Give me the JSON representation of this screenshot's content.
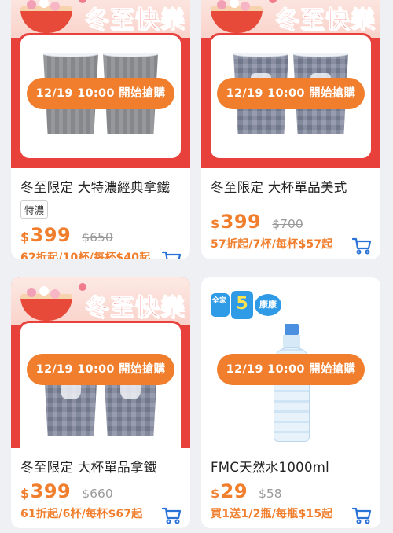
{
  "products": [
    {
      "image_theme": "winter-solstice",
      "banner_title": "冬至快樂",
      "sale_pill": "12/19 10:00 開始搶購",
      "name": "冬至限定 大特濃經典拿鐵",
      "tag": "特濃",
      "currency": "$",
      "price": "399",
      "original_price": "$650",
      "promo": "62折起/10杯/每杯$40起"
    },
    {
      "image_theme": "winter-solstice",
      "banner_title": "冬至快樂",
      "sale_pill": "12/19 10:00 開始搶購",
      "name": "冬至限定 大杯單品美式",
      "tag": "",
      "currency": "$",
      "price": "399",
      "original_price": "$700",
      "promo": "57折起/7杯/每杯$57起"
    },
    {
      "image_theme": "winter-solstice",
      "banner_title": "冬至快樂",
      "sale_pill": "12/19 10:00 開始搶購",
      "name": "冬至限定 大杯單品拿鐵",
      "tag": "",
      "currency": "$",
      "price": "399",
      "original_price": "$660",
      "promo": "61折起/6杯/每杯$67起"
    },
    {
      "image_theme": "water-bottle",
      "logo_text": {
        "a": "全家",
        "b": "5",
        "c": "康康"
      },
      "sale_pill": "12/19 10:00 開始搶購",
      "name": "FMC天然水1000ml",
      "tag": "",
      "currency": "$",
      "price": "29",
      "original_price": "$58",
      "promo": "買1送1/2瓶/每瓶$15起"
    }
  ],
  "colors": {
    "accent_orange": "#f07e2c",
    "festive_red": "#e8403a",
    "background": "#eef0f3",
    "cart_icon": "#2a72d6"
  },
  "icons": {
    "cart": "shopping-cart-icon"
  }
}
